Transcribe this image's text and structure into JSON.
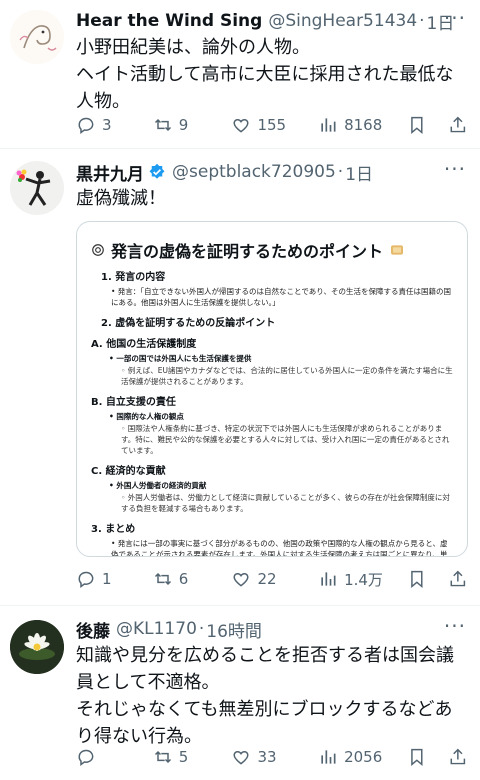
{
  "tweets": [
    {
      "name": "Hear the Wind Sing",
      "handle": "@SingHear51434",
      "time": "1日",
      "text": "小野田紀美は、論外の人物。\nヘイト活動して高市に大臣に採用された最低な人物。",
      "replies": "3",
      "retweets": "9",
      "likes": "155",
      "views": "8168"
    },
    {
      "name": "黒井九月",
      "handle": "@septblack720905",
      "time": "1日",
      "text": "虚偽殲滅！",
      "replies": "1",
      "retweets": "6",
      "likes": "22",
      "views": "1.4万",
      "card": {
        "title": "発言の虚偽を証明するためのポイント",
        "s1": "1. 発言の内容",
        "s1_text": "• 発言：「自立できない外国人が帰国するのは自然なことであり、その生活を保障する責任は国籍の国にある。他国は外国人に生活保護を提供しない。」",
        "s2": "2. 虚偽を証明するための反論ポイント",
        "a": "A. 他国の生活保護制度",
        "a_b": "• 一部の国では外国人にも生活保護を提供",
        "a_t": "◦ 例えば、EU諸国やカナダなどでは、合法的に居住している外国人に一定の条件を満たす場合に生活保護が提供されることがあります。",
        "b": "B. 自立支援の責任",
        "b_b": "• 国際的な人権の観点",
        "b_t": "◦ 国際法や人権条約に基づき、特定の状況下では外国人にも生活保障が求められることがあります。特に、難民や公的な保護を必要とする人々に対しては、受け入れ国に一定の責任があるとされています。",
        "c": "C. 経済的な貢献",
        "c_b": "• 外国人労働者の経済的貢献",
        "c_t": "◦ 外国人労働者は、労働力として経済に貢献していることが多く、彼らの存在が社会保障制度に対する負担を軽減する場合もあります。",
        "s3": "3. まとめ",
        "s3_text": "• 発言には一部の事実に基づく部分があるものの、他国の政策や国際的な人権の観点から見ると、虚偽であることが示される要素が存在します。外国人に対する生活保障の考え方は国ごとに異なり、単純に「他国は提供しない」とするのは不正確です。"
      }
    },
    {
      "name": "後藤",
      "handle": "@KL1170",
      "time": "16時間",
      "text": "知識や見分を広めることを拒否する者は国会議員として不適格。\nそれじゃなくても無差別にブロックするなどあり得ない行為。",
      "replies": "",
      "retweets": "5",
      "likes": "33",
      "views": "2056"
    }
  ],
  "colors": {
    "muted": "#536471",
    "text": "#0f1419",
    "verified": "#1d9bf0"
  }
}
